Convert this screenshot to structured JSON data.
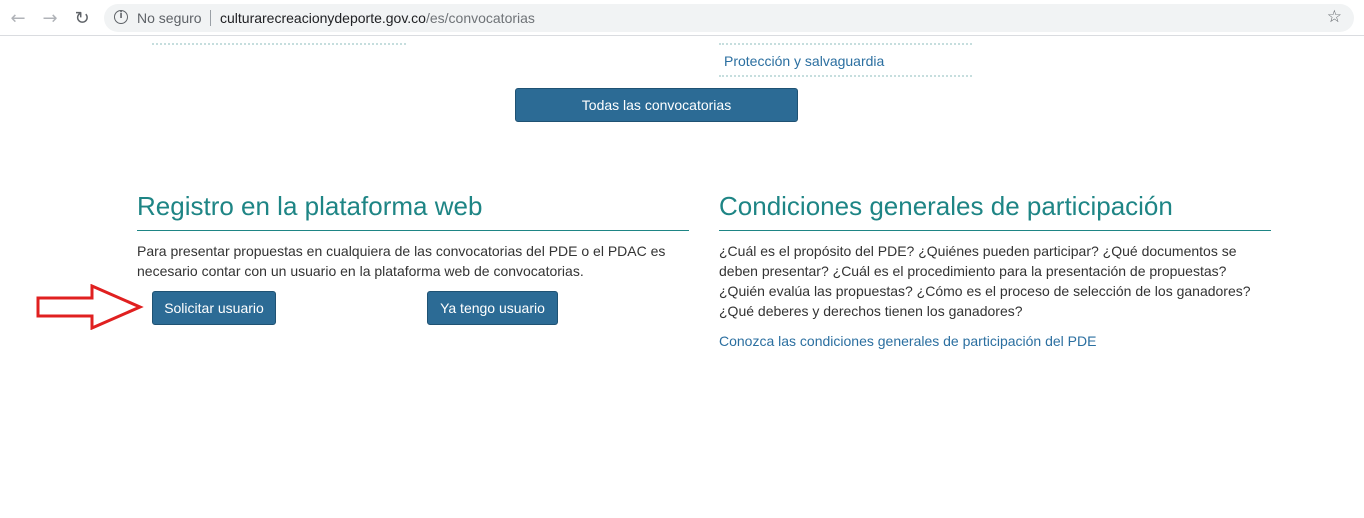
{
  "browser": {
    "security_label": "No seguro",
    "url_domain": "culturarecreacionydeporte.gov.co",
    "url_path": "/es/convocatorias",
    "icons": [
      "back-arrow-icon",
      "forward-arrow-icon",
      "reload-icon",
      "info-icon",
      "star-icon"
    ]
  },
  "top": {
    "link_label": "Protección y salvaguardia",
    "all_button_label": "Todas las convocatorias"
  },
  "registro": {
    "title": "Registro en la plataforma web",
    "description": "Para presentar propuestas en cualquiera de las convocatorias del PDE o el PDAC es necesario contar con un usuario en la plataforma web de convocatorias.",
    "request_button_label": "Solicitar usuario",
    "have_button_label": "Ya tengo usuario"
  },
  "condiciones": {
    "title": "Condiciones generales de participación",
    "description": "¿Cuál es el propósito del PDE? ¿Quiénes pueden participar? ¿Qué documentos se deben presentar? ¿Cuál es el procedimiento para la presentación de propuestas? ¿Quién evalúa las propuestas? ¿Cómo es el proceso de selección de los ganadores? ¿Qué deberes y derechos tienen los ganadores?",
    "link_label": "Conozca las condiciones generales de participación del PDE"
  },
  "colors": {
    "accent_teal": "#1e8585",
    "button_blue": "#2c6b95",
    "link_blue": "#2b6fa0",
    "annotation_red": "#e02020"
  }
}
